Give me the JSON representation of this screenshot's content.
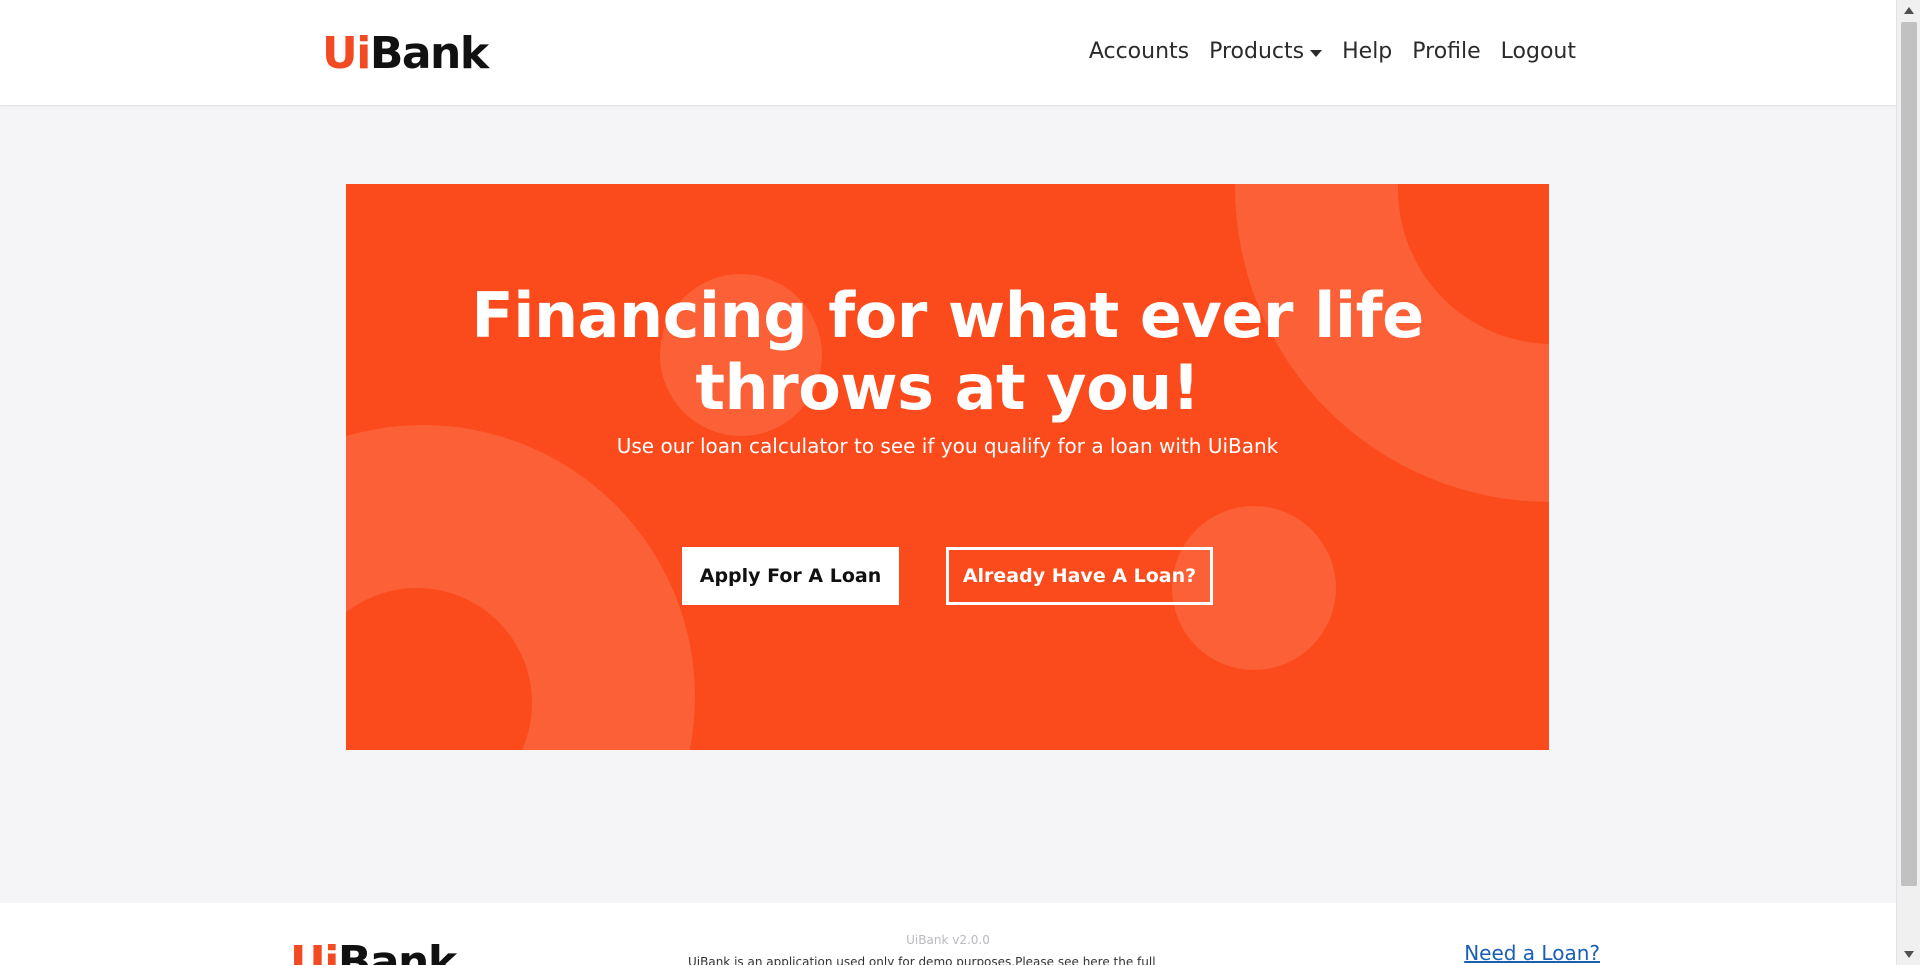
{
  "brand": {
    "logo_ui": "Ui",
    "logo_bank": "Bank",
    "accent": "#f24a22"
  },
  "nav": {
    "items": [
      {
        "label": "Accounts"
      },
      {
        "label": "Products",
        "has_dropdown": true
      },
      {
        "label": "Help"
      },
      {
        "label": "Profile"
      },
      {
        "label": "Logout"
      }
    ]
  },
  "hero": {
    "background": "#fb4a1b",
    "title_line1": "Financing for what ever life",
    "title_line2": "throws at you!",
    "subtitle": "Use our loan calculator to see if you qualify for a loan with UiBank",
    "apply_label": "Apply For A Loan",
    "existing_label": "Already Have A Loan?"
  },
  "footer": {
    "version": "UiBank v2.0.0",
    "text": "UiBank is an application used only for demo purposes.Please see here the full",
    "need_loan": "Need a Loan?"
  }
}
